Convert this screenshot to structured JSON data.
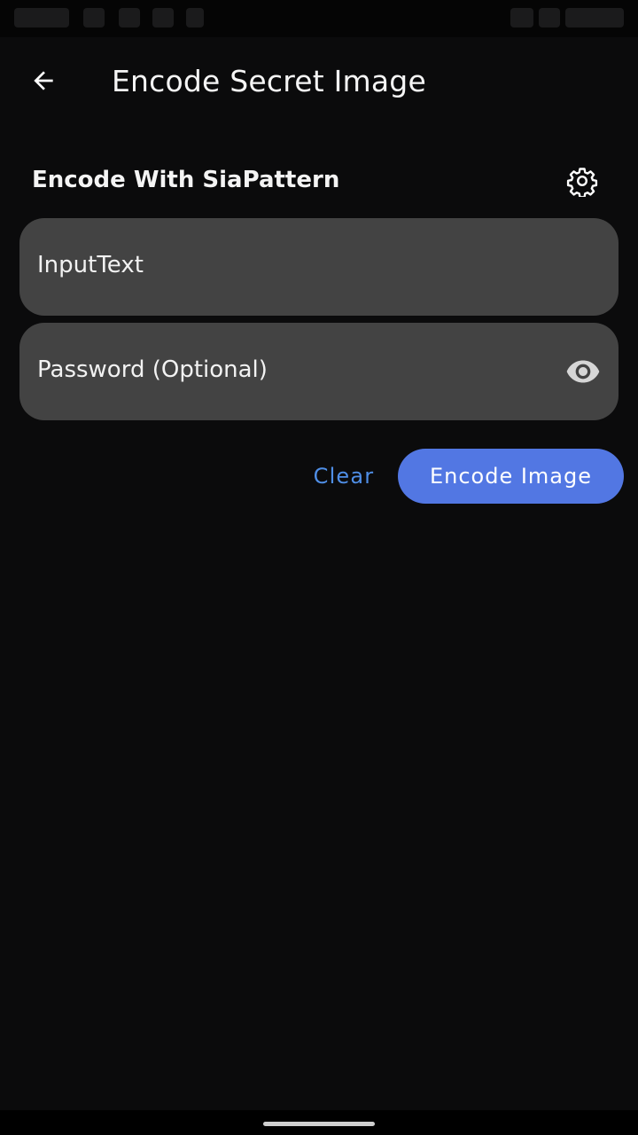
{
  "app_bar": {
    "title": "Encode Secret Image",
    "back_icon": "arrow-back-icon"
  },
  "section": {
    "title": "Encode With SiaPattern",
    "settings_icon": "gear-icon"
  },
  "fields": {
    "input_text": {
      "placeholder": "InputText",
      "value": ""
    },
    "password": {
      "placeholder": "Password (Optional)",
      "value": "",
      "visibility_icon": "eye-icon"
    }
  },
  "actions": {
    "clear_label": "Clear",
    "encode_label": "Encode Image"
  },
  "colors": {
    "background": "#0b0b0c",
    "field_background": "#434343",
    "accent": "#5277e3",
    "clear_text": "#4f8ee6"
  }
}
